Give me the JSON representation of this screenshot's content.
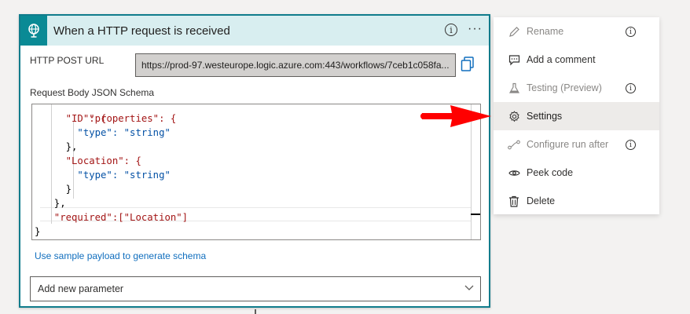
{
  "card": {
    "title": "When a HTTP request is received",
    "info_glyph": "i",
    "more_glyph": "···",
    "http_post_url_label": "HTTP POST URL",
    "http_post_url_value": "https://prod-97.westeurope.logic.azure.com:443/workflows/7ceb1c058fa...",
    "schema_label": "Request Body JSON Schema",
    "code_lines": [
      "  \"properties\": {",
      "    \"ID\": {",
      "      \"type\": \"string\"",
      "    },",
      "    \"Location\": {",
      "      \"type\": \"string\"",
      "    }",
      "  },",
      "  \"required\":[\"Location\"]",
      "}"
    ],
    "sample_payload_link": "Use sample payload to generate schema",
    "add_parameter_placeholder": "Add new parameter"
  },
  "menu": {
    "items": [
      {
        "label": "Rename",
        "icon": "pencil-icon",
        "disabled": true,
        "info": true
      },
      {
        "label": "Add a comment",
        "icon": "comment-icon",
        "disabled": false,
        "info": false
      },
      {
        "label": "Testing (Preview)",
        "icon": "flask-icon",
        "disabled": true,
        "info": true
      },
      {
        "label": "Settings",
        "icon": "gear-icon",
        "disabled": false,
        "info": false,
        "highlighted": true
      },
      {
        "label": "Configure run after",
        "icon": "run-after-icon",
        "disabled": true,
        "info": true
      },
      {
        "label": "Peek code",
        "icon": "eye-icon",
        "disabled": false,
        "info": false
      },
      {
        "label": "Delete",
        "icon": "trash-icon",
        "disabled": false,
        "info": false
      }
    ]
  },
  "colors": {
    "accent": "#107c8c",
    "header_bg": "#d8eef0",
    "link": "#106ebe",
    "arrow": "#ff0000"
  }
}
